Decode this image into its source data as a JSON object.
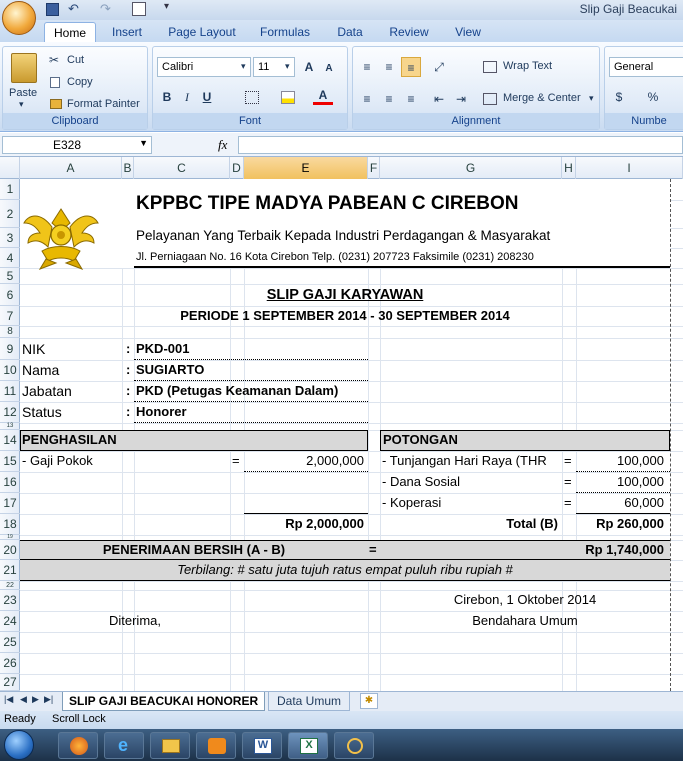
{
  "window": {
    "title": "Slip Gaji Beacukai"
  },
  "tabs": [
    "Home",
    "Insert",
    "Page Layout",
    "Formulas",
    "Data",
    "Review",
    "View"
  ],
  "ribbon": {
    "clipboard": {
      "paste": "Paste",
      "cut": "Cut",
      "copy": "Copy",
      "format_painter": "Format Painter",
      "label": "Clipboard"
    },
    "font": {
      "name": "Calibri",
      "size": "11",
      "label": "Font",
      "bold": "B",
      "italic": "I",
      "underline": "U"
    },
    "alignment": {
      "wrap": "Wrap Text",
      "merge": "Merge & Center",
      "label": "Alignment"
    },
    "number": {
      "format": "General",
      "currency": "$",
      "percent": "%",
      "label": "Numbe"
    }
  },
  "formula_bar": {
    "name_box": "E328",
    "fx": "fx",
    "content": ""
  },
  "columns": [
    "A",
    "B",
    "C",
    "D",
    "E",
    "F",
    "G",
    "H",
    "I"
  ],
  "rows": [
    "1",
    "2",
    "3",
    "4",
    "5",
    "6",
    "7",
    "8",
    "9",
    "10",
    "11",
    "12",
    "13",
    "14",
    "15",
    "16",
    "17",
    "18",
    "19",
    "20",
    "21",
    "22",
    "23",
    "24",
    "25",
    "26",
    "27"
  ],
  "sheet": {
    "org": "KPPBC TIPE MADYA PABEAN C CIREBON",
    "tagline": "Pelayanan Yang Terbaik Kepada Industri Perdagangan & Masyarakat",
    "address": "Jl. Perniagaan No. 16 Kota Cirebon Telp. (0231) 207723 Faksimile (0231) 208230",
    "slip_title": "SLIP GAJI KARYAWAN",
    "period": "PERIODE 1 SEPTEMBER 2014 - 30 SEPTEMBER 2014",
    "nik_label": "NIK",
    "nik": "PKD-001",
    "nama_label": "Nama",
    "nama": "SUGIARTO",
    "jabatan_label": "Jabatan",
    "jabatan": "PKD (Petugas Keamanan Dalam)",
    "status_label": "Status",
    "status": "Honorer",
    "colon": ":",
    "penghasilan": "PENGHASILAN",
    "potongan": "POTONGAN",
    "gaji_pokok_label": "- Gaji Pokok",
    "gaji_pokok": "2,000,000",
    "thr_label": "- Tunjangan Hari Raya (THR",
    "thr": "100,000",
    "dana_sosial_label": "- Dana Sosial",
    "dana_sosial": "100,000",
    "koperasi_label": "- Koperasi",
    "koperasi": "60,000",
    "eq": "=",
    "total_a": "Rp 2,000,000",
    "total_b_label": "Total (B)",
    "total_b": "Rp 260,000",
    "bersih_label": "PENERIMAAN BERSIH (A - B)",
    "bersih": "Rp 1,740,000",
    "terbilang": "Terbilang: # satu juta tujuh ratus empat puluh ribu rupiah #",
    "place_date": "Cirebon, 1 Oktober 2014",
    "diterima": "Diterima,",
    "bendahara": "Bendahara Umum"
  },
  "sheet_tabs": [
    "SLIP GAJI BEACUKAI HONORER",
    "Data Umum"
  ],
  "status": {
    "ready": "Ready",
    "scroll_lock": "Scroll Lock"
  },
  "colors": {
    "accent": "#15428b",
    "header_fill": "#d8d8d8",
    "logo": "#e8b800"
  }
}
